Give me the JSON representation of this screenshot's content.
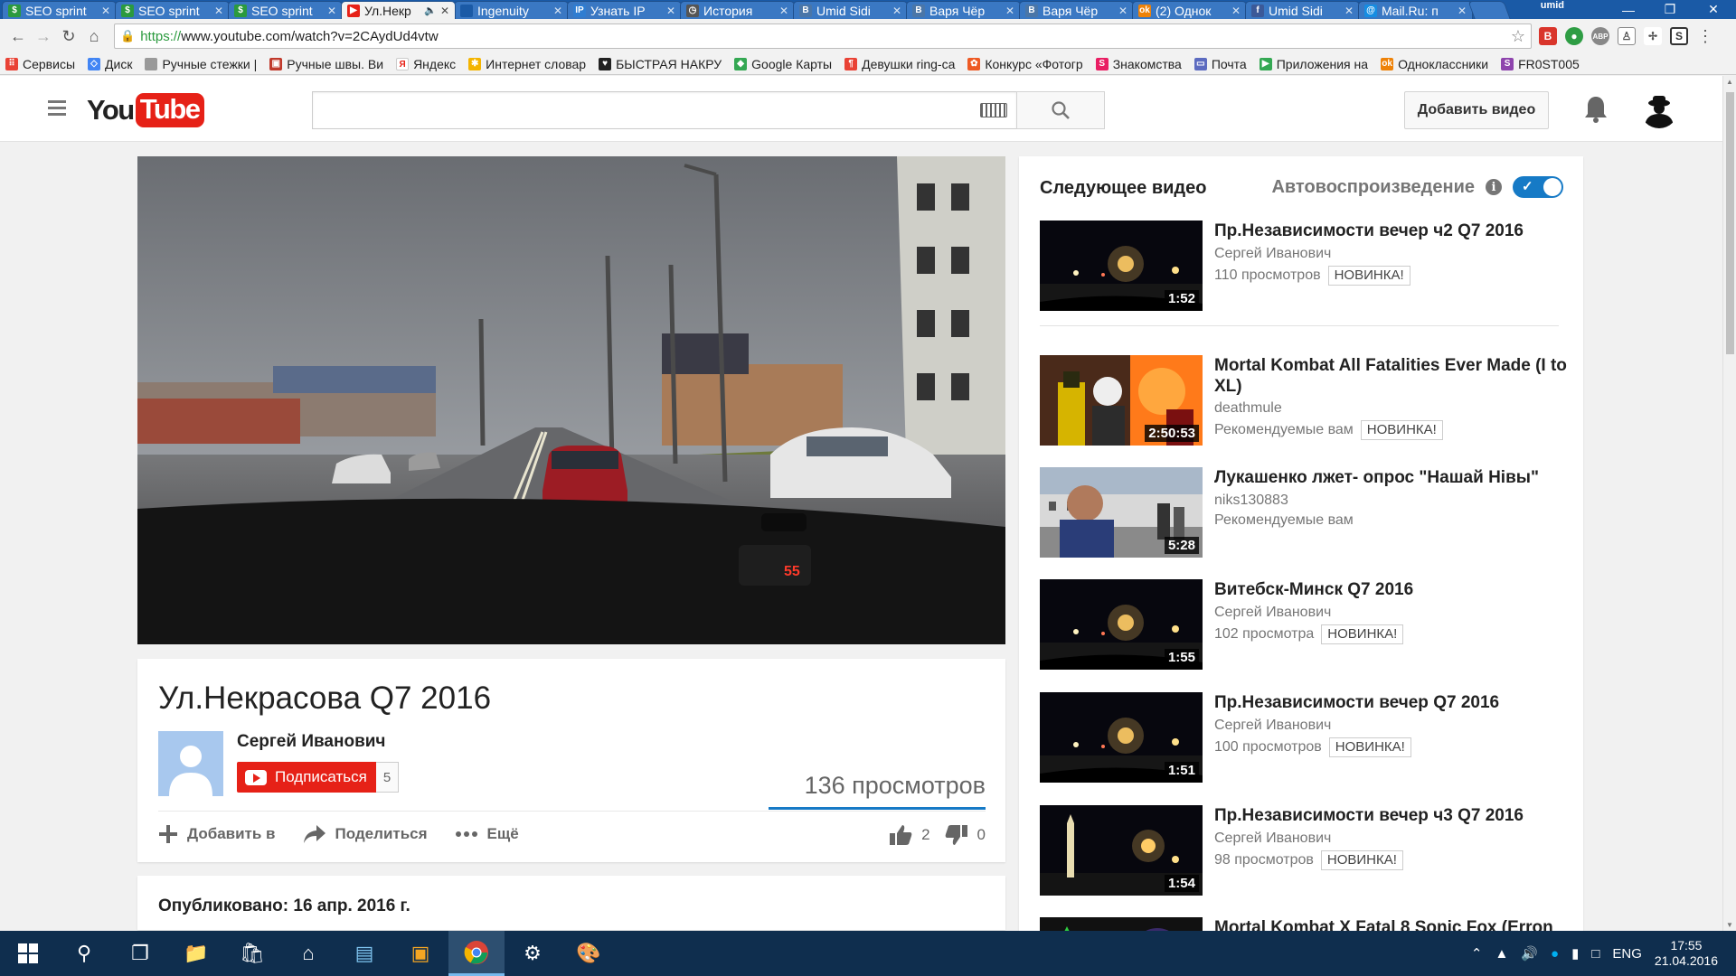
{
  "browser": {
    "tabs": [
      {
        "title": "SEO sprint",
        "fav_color": "#2b9a3e",
        "fav": "$"
      },
      {
        "title": "SEO sprint",
        "fav_color": "#2b9a3e",
        "fav": "$"
      },
      {
        "title": "SEO sprint",
        "fav_color": "#2b9a3e",
        "fav": "$"
      },
      {
        "title": "Ул.Некр",
        "fav_color": "#e62117",
        "fav": "▶"
      },
      {
        "title": "Ingenuity",
        "fav_color": "#1a5aa6",
        "fav": ""
      },
      {
        "title": "Узнать IP",
        "fav_color": "#2f7dd1",
        "fav": "IP"
      },
      {
        "title": "История",
        "fav_color": "#555555",
        "fav": "◷"
      },
      {
        "title": "Umid Sidi",
        "fav_color": "#4a76a8",
        "fav": "B"
      },
      {
        "title": "Варя Чёр",
        "fav_color": "#4a76a8",
        "fav": "B"
      },
      {
        "title": "Варя Чёр",
        "fav_color": "#4a76a8",
        "fav": "B"
      },
      {
        "title": "(2) Однок",
        "fav_color": "#ee8208",
        "fav": "ok"
      },
      {
        "title": "Umid Sidi",
        "fav_color": "#3b5998",
        "fav": "f"
      },
      {
        "title": "Mail.Ru: п",
        "fav_color": "#168de2",
        "fav": "@"
      }
    ],
    "user_label": "umid",
    "url_scheme": "https://",
    "url_rest": "www.youtube.com/watch?v=2CAydUd4vtw",
    "bookmarks": [
      {
        "label": "Сервисы",
        "color": "#e94235",
        "fav": "⠿"
      },
      {
        "label": "Диск",
        "color": "#4285f4",
        "fav": "◇"
      },
      {
        "label": "Ручные стежки |",
        "color": "#999999",
        "fav": ""
      },
      {
        "label": "Ручные швы. Ви",
        "color": "#c0392b",
        "fav": "▣"
      },
      {
        "label": "Яндекс",
        "color": "#ffffff",
        "fav": "Я"
      },
      {
        "label": "Интернет словар",
        "color": "#f4b400",
        "fav": "✱"
      },
      {
        "label": "БЫСТРАЯ НАКРУ",
        "color": "#222222",
        "fav": "♥"
      },
      {
        "label": "Google Карты",
        "color": "#34a853",
        "fav": "◆"
      },
      {
        "label": "Девушки ring-ca",
        "color": "#e94235",
        "fav": "¶"
      },
      {
        "label": "Конкурс «Фотогр",
        "color": "#ee5a24",
        "fav": "✿"
      },
      {
        "label": "Знакомства",
        "color": "#e91e63",
        "fav": "S"
      },
      {
        "label": "Почта",
        "color": "#5c6bc0",
        "fav": "▭"
      },
      {
        "label": "Приложения на",
        "color": "#34a853",
        "fav": "▶"
      },
      {
        "label": "Одноклассники",
        "color": "#ee8208",
        "fav": "ok"
      },
      {
        "label": "FR0ST005",
        "color": "#8e44ad",
        "fav": "S"
      }
    ]
  },
  "youtube": {
    "logo_you": "You",
    "logo_tube": "Tube",
    "search_placeholder": "",
    "upload_label": "Добавить видео"
  },
  "video": {
    "title": "Ул.Некрасова Q7 2016",
    "channel": "Сергей Иванович",
    "subscribe_label": "Подписаться",
    "subscribers": "5",
    "views": "136 просмотров",
    "add_label": "Добавить в",
    "share_label": "Поделиться",
    "more_label": "Ещё",
    "likes": "2",
    "dislikes": "0",
    "published": "Опубликовано: 16 апр. 2016 г.",
    "dash_readout": "55"
  },
  "sidebar": {
    "up_next_label": "Следующее видео",
    "autoplay_label": "Автовоспроизведение",
    "autoplay_on": true,
    "items": [
      {
        "title": "Пр.Независимости вечер ч2 Q7 2016",
        "channel": "Сергей Иванович",
        "meta": "110 просмотров",
        "badge": "НОВИНКА!",
        "duration": "1:52",
        "scene": "night"
      },
      {
        "title": "Mortal Kombat All Fatalities Ever Made (I to XL)",
        "channel": "deathmule",
        "meta": "Рекомендуемые вам",
        "badge": "НОВИНКА!",
        "duration": "2:50:53",
        "scene": "mk"
      },
      {
        "title": "Лукашенко лжет- опрос \"Нашай Нівы\"",
        "channel": "niks130883",
        "meta": "Рекомендуемые вам",
        "badge": "",
        "duration": "5:28",
        "scene": "street"
      },
      {
        "title": "Витебск-Минск Q7 2016",
        "channel": "Сергей Иванович",
        "meta": "102 просмотра",
        "badge": "НОВИНКА!",
        "duration": "1:55",
        "scene": "night"
      },
      {
        "title": "Пр.Независимости вечер Q7 2016",
        "channel": "Сергей Иванович",
        "meta": "100 просмотров",
        "badge": "НОВИНКА!",
        "duration": "1:51",
        "scene": "night"
      },
      {
        "title": "Пр.Независимости вечер ч3 Q7 2016",
        "channel": "Сергей Иванович",
        "meta": "98 просмотров",
        "badge": "НОВИНКА!",
        "duration": "1:54",
        "scene": "monument"
      },
      {
        "title": "Mortal Kombat X Fatal 8 Sonic Fox (Erron",
        "channel": "",
        "meta": "",
        "badge": "",
        "duration": "",
        "scene": "green"
      }
    ]
  },
  "taskbar": {
    "lang": "ENG",
    "time": "17:55",
    "date": "21.04.2016"
  }
}
